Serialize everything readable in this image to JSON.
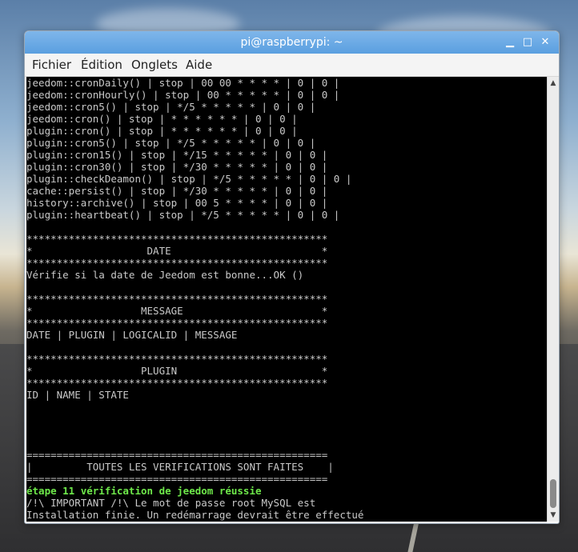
{
  "window": {
    "title": "pi@raspberrypi: ~",
    "minimize_glyph": "▁",
    "maximize_glyph": "□",
    "close_glyph": "✕"
  },
  "menu": {
    "items": [
      "Fichier",
      "Édition",
      "Onglets",
      "Aide"
    ]
  },
  "terminal": {
    "lines": [
      "jeedom::cronDaily() | stop | 00 00 * * * * | 0 | 0 |",
      "jeedom::cronHourly() | stop | 00 * * * * * | 0 | 0 |",
      "jeedom::cron5() | stop | */5 * * * * * | 0 | 0 |",
      "jeedom::cron() | stop | * * * * * * | 0 | 0 |",
      "plugin::cron() | stop | * * * * * * | 0 | 0 |",
      "plugin::cron5() | stop | */5 * * * * * | 0 | 0 |",
      "plugin::cron15() | stop | */15 * * * * * | 0 | 0 |",
      "plugin::cron30() | stop | */30 * * * * * | 0 | 0 |",
      "plugin::checkDeamon() | stop | */5 * * * * * | 0 | 0 |",
      "cache::persist() | stop | */30 * * * * * | 0 | 0 |",
      "history::archive() | stop | 00 5 * * * * | 0 | 0 |",
      "plugin::heartbeat() | stop | */5 * * * * * | 0 | 0 |",
      "",
      "**************************************************",
      "*                   DATE                         *",
      "**************************************************",
      "Vérifie si la date de Jeedom est bonne...OK ()",
      "",
      "**************************************************",
      "*                  MESSAGE                       *",
      "**************************************************",
      "DATE | PLUGIN | LOGICALID | MESSAGE",
      "",
      "**************************************************",
      "*                  PLUGIN                        *",
      "**************************************************",
      "ID | NAME | STATE",
      "",
      "",
      "",
      "",
      "==================================================",
      "|         TOUTES LES VERIFICATIONS SONT FAITES    |",
      "==================================================",
      "étape 11 vérification de jeedom réussie",
      "/!\\ IMPORTANT /!\\ Le mot de passe root MySQL est",
      "Installation finie. Un redémarrage devrait être effectué"
    ],
    "green_line_index": 34,
    "prompt_user": "pi@raspberrypi",
    "prompt_sep": ":",
    "prompt_path": "~ $",
    "scrollbar_position": 0.95
  }
}
